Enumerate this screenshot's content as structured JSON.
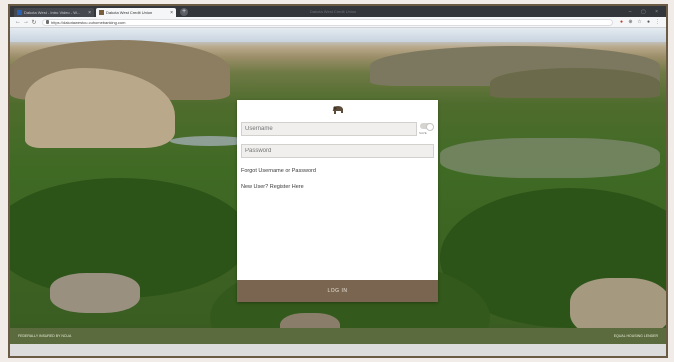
{
  "browser": {
    "tabs": [
      {
        "label": "Dakota West - Intro Video - W...",
        "active": false
      },
      {
        "label": "Dakota West Credit Union",
        "active": true
      }
    ],
    "new_tab": "+",
    "window_title": "Dakota West Credit Union",
    "url": "https://dakotawestcu.cuhomebanking.com",
    "nav": {
      "back": "←",
      "forward": "→",
      "reload": "↻"
    }
  },
  "login": {
    "username_placeholder": "Username",
    "save_label": "SAVE",
    "password_placeholder": "Password",
    "forgot_link": "Forgot Username or Password",
    "register_link": "New User? Register Here",
    "login_button": "LOG IN"
  },
  "footer": {
    "left": "FEDERALLY INSURED BY NCUA",
    "right": "EQUAL HOUSING LENDER"
  },
  "colors": {
    "brand": "#7a6650",
    "footer": "#5b6b3d",
    "frame": "#6b5a44"
  }
}
